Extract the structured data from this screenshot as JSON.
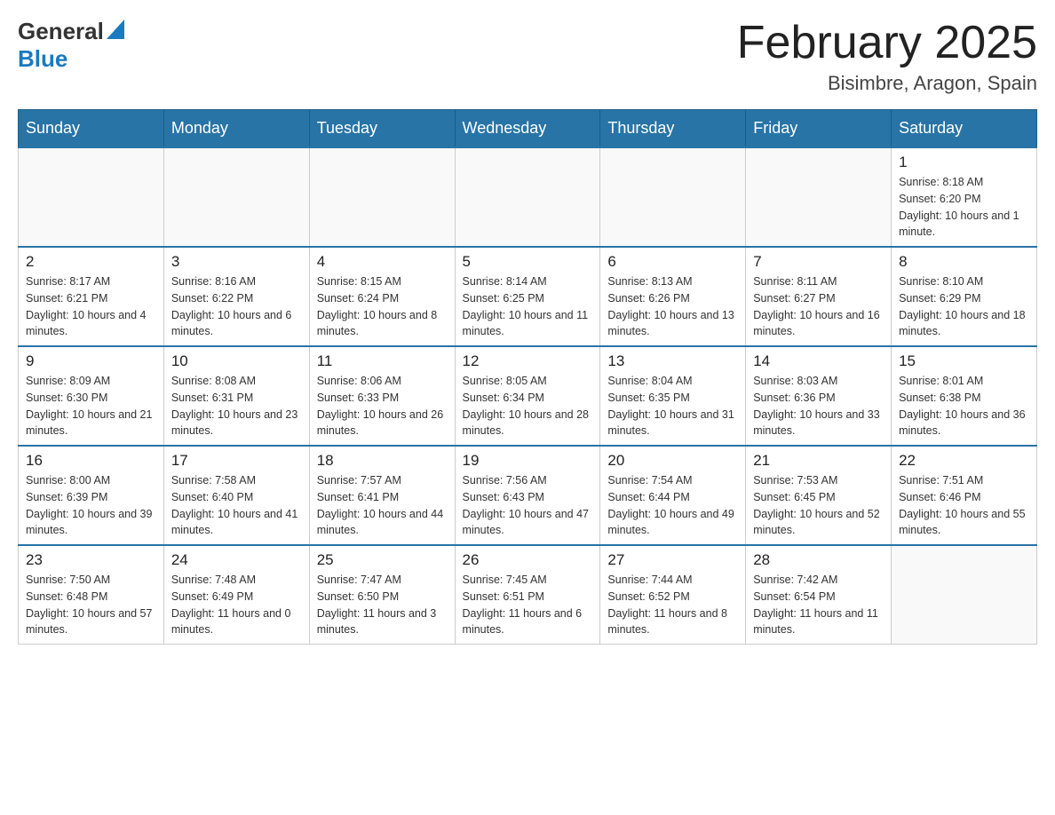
{
  "header": {
    "logo_general": "General",
    "logo_blue": "Blue",
    "month_title": "February 2025",
    "location": "Bisimbre, Aragon, Spain"
  },
  "weekdays": [
    "Sunday",
    "Monday",
    "Tuesday",
    "Wednesday",
    "Thursday",
    "Friday",
    "Saturday"
  ],
  "weeks": [
    [
      {
        "day": "",
        "info": ""
      },
      {
        "day": "",
        "info": ""
      },
      {
        "day": "",
        "info": ""
      },
      {
        "day": "",
        "info": ""
      },
      {
        "day": "",
        "info": ""
      },
      {
        "day": "",
        "info": ""
      },
      {
        "day": "1",
        "info": "Sunrise: 8:18 AM\nSunset: 6:20 PM\nDaylight: 10 hours and 1 minute."
      }
    ],
    [
      {
        "day": "2",
        "info": "Sunrise: 8:17 AM\nSunset: 6:21 PM\nDaylight: 10 hours and 4 minutes."
      },
      {
        "day": "3",
        "info": "Sunrise: 8:16 AM\nSunset: 6:22 PM\nDaylight: 10 hours and 6 minutes."
      },
      {
        "day": "4",
        "info": "Sunrise: 8:15 AM\nSunset: 6:24 PM\nDaylight: 10 hours and 8 minutes."
      },
      {
        "day": "5",
        "info": "Sunrise: 8:14 AM\nSunset: 6:25 PM\nDaylight: 10 hours and 11 minutes."
      },
      {
        "day": "6",
        "info": "Sunrise: 8:13 AM\nSunset: 6:26 PM\nDaylight: 10 hours and 13 minutes."
      },
      {
        "day": "7",
        "info": "Sunrise: 8:11 AM\nSunset: 6:27 PM\nDaylight: 10 hours and 16 minutes."
      },
      {
        "day": "8",
        "info": "Sunrise: 8:10 AM\nSunset: 6:29 PM\nDaylight: 10 hours and 18 minutes."
      }
    ],
    [
      {
        "day": "9",
        "info": "Sunrise: 8:09 AM\nSunset: 6:30 PM\nDaylight: 10 hours and 21 minutes."
      },
      {
        "day": "10",
        "info": "Sunrise: 8:08 AM\nSunset: 6:31 PM\nDaylight: 10 hours and 23 minutes."
      },
      {
        "day": "11",
        "info": "Sunrise: 8:06 AM\nSunset: 6:33 PM\nDaylight: 10 hours and 26 minutes."
      },
      {
        "day": "12",
        "info": "Sunrise: 8:05 AM\nSunset: 6:34 PM\nDaylight: 10 hours and 28 minutes."
      },
      {
        "day": "13",
        "info": "Sunrise: 8:04 AM\nSunset: 6:35 PM\nDaylight: 10 hours and 31 minutes."
      },
      {
        "day": "14",
        "info": "Sunrise: 8:03 AM\nSunset: 6:36 PM\nDaylight: 10 hours and 33 minutes."
      },
      {
        "day": "15",
        "info": "Sunrise: 8:01 AM\nSunset: 6:38 PM\nDaylight: 10 hours and 36 minutes."
      }
    ],
    [
      {
        "day": "16",
        "info": "Sunrise: 8:00 AM\nSunset: 6:39 PM\nDaylight: 10 hours and 39 minutes."
      },
      {
        "day": "17",
        "info": "Sunrise: 7:58 AM\nSunset: 6:40 PM\nDaylight: 10 hours and 41 minutes."
      },
      {
        "day": "18",
        "info": "Sunrise: 7:57 AM\nSunset: 6:41 PM\nDaylight: 10 hours and 44 minutes."
      },
      {
        "day": "19",
        "info": "Sunrise: 7:56 AM\nSunset: 6:43 PM\nDaylight: 10 hours and 47 minutes."
      },
      {
        "day": "20",
        "info": "Sunrise: 7:54 AM\nSunset: 6:44 PM\nDaylight: 10 hours and 49 minutes."
      },
      {
        "day": "21",
        "info": "Sunrise: 7:53 AM\nSunset: 6:45 PM\nDaylight: 10 hours and 52 minutes."
      },
      {
        "day": "22",
        "info": "Sunrise: 7:51 AM\nSunset: 6:46 PM\nDaylight: 10 hours and 55 minutes."
      }
    ],
    [
      {
        "day": "23",
        "info": "Sunrise: 7:50 AM\nSunset: 6:48 PM\nDaylight: 10 hours and 57 minutes."
      },
      {
        "day": "24",
        "info": "Sunrise: 7:48 AM\nSunset: 6:49 PM\nDaylight: 11 hours and 0 minutes."
      },
      {
        "day": "25",
        "info": "Sunrise: 7:47 AM\nSunset: 6:50 PM\nDaylight: 11 hours and 3 minutes."
      },
      {
        "day": "26",
        "info": "Sunrise: 7:45 AM\nSunset: 6:51 PM\nDaylight: 11 hours and 6 minutes."
      },
      {
        "day": "27",
        "info": "Sunrise: 7:44 AM\nSunset: 6:52 PM\nDaylight: 11 hours and 8 minutes."
      },
      {
        "day": "28",
        "info": "Sunrise: 7:42 AM\nSunset: 6:54 PM\nDaylight: 11 hours and 11 minutes."
      },
      {
        "day": "",
        "info": ""
      }
    ]
  ]
}
